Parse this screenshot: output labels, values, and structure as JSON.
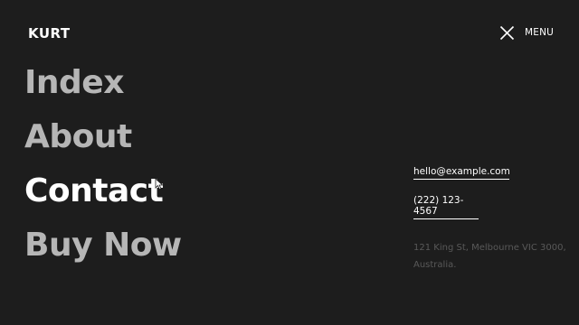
{
  "brand": {
    "logo_text": "KURT"
  },
  "header": {
    "menu_label": "MENU",
    "close_icon": "close-icon"
  },
  "nav": {
    "items": [
      {
        "label": "Index",
        "active": false
      },
      {
        "label": "About",
        "active": false
      },
      {
        "label": "Contact",
        "active": true
      },
      {
        "label": "Buy Now",
        "active": false
      }
    ]
  },
  "contact": {
    "email": "hello@example.com",
    "phone": "(222) 123-4567",
    "address": "121 King St, Melbourne VIC 3000, Australia."
  },
  "colors": {
    "background": "#1d1d1d",
    "nav_inactive": "#b6b6b6",
    "nav_active": "#ffffff",
    "address_text": "#595959"
  }
}
